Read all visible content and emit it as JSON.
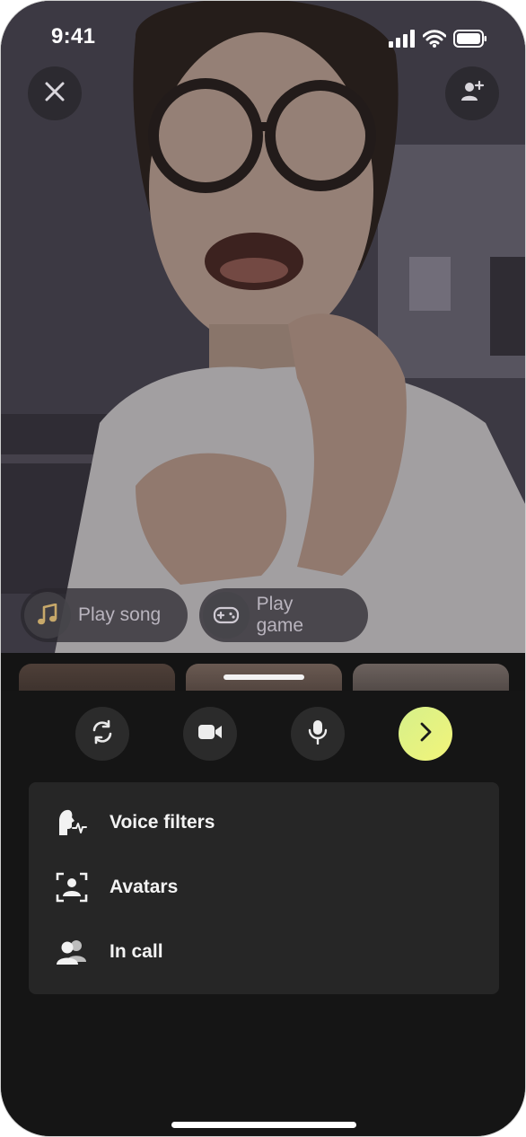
{
  "status_bar": {
    "time": "9:41",
    "icons": [
      "cellular-signal-icon",
      "wifi-icon",
      "battery-icon"
    ]
  },
  "video": {
    "top_buttons": {
      "close_icon": "close-icon",
      "add_participant_icon": "person-add-icon"
    },
    "pills": [
      {
        "icon": "music-note-icon",
        "label": "Play song"
      },
      {
        "icon": "gamepad-icon",
        "label": "Play game"
      }
    ]
  },
  "controls": [
    {
      "icon": "flip-camera-icon"
    },
    {
      "icon": "video-camera-icon"
    },
    {
      "icon": "microphone-icon"
    },
    {
      "icon": "chevron-right-icon",
      "accent": "#e4f27e"
    }
  ],
  "menu": {
    "items": [
      {
        "icon": "voice-filter-icon",
        "label": "Voice filters"
      },
      {
        "icon": "avatar-scan-icon",
        "label": "Avatars"
      },
      {
        "icon": "people-icon",
        "label": "In call"
      }
    ]
  },
  "colors": {
    "sheet_bg": "#151515",
    "menu_bg": "#262626",
    "control_bg": "#2b2b2b",
    "accent": "#e4f27e",
    "text": "#f3f3f3"
  }
}
